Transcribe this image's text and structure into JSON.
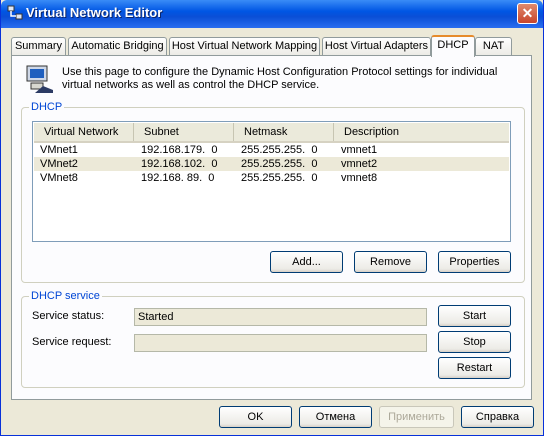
{
  "window": {
    "title": "Virtual Network Editor",
    "close_label": "✕"
  },
  "tabs": [
    {
      "label": "Summary"
    },
    {
      "label": "Automatic Bridging"
    },
    {
      "label": "Host Virtual Network Mapping"
    },
    {
      "label": "Host Virtual Adapters"
    },
    {
      "label": "DHCP",
      "active": true
    },
    {
      "label": "NAT"
    }
  ],
  "info": {
    "text": "Use this page to configure the Dynamic Host Configuration Protocol settings for individual virtual networks as well as control the DHCP service."
  },
  "dhcp": {
    "group_label": "DHCP",
    "columns": [
      "Virtual Network",
      "Subnet",
      "Netmask",
      "Description"
    ],
    "rows": [
      [
        "VMnet1",
        "192.168.179.  0",
        "255.255.255.  0",
        "vmnet1"
      ],
      [
        "VMnet2",
        "192.168.102.  0",
        "255.255.255.  0",
        "vmnet2"
      ],
      [
        "VMnet8",
        "192.168. 89.  0",
        "255.255.255.  0",
        "vmnet8"
      ]
    ],
    "add_label": "Add...",
    "remove_label": "Remove",
    "properties_label": "Properties"
  },
  "service": {
    "group_label": "DHCP service",
    "status_label": "Service status:",
    "status_value": "Started",
    "request_label": "Service request:",
    "request_value": "",
    "start_label": "Start",
    "stop_label": "Stop",
    "restart_label": "Restart"
  },
  "footer": {
    "ok_label": "OK",
    "cancel_label": "Отмена",
    "apply_label": "Применить",
    "help_label": "Справка"
  }
}
